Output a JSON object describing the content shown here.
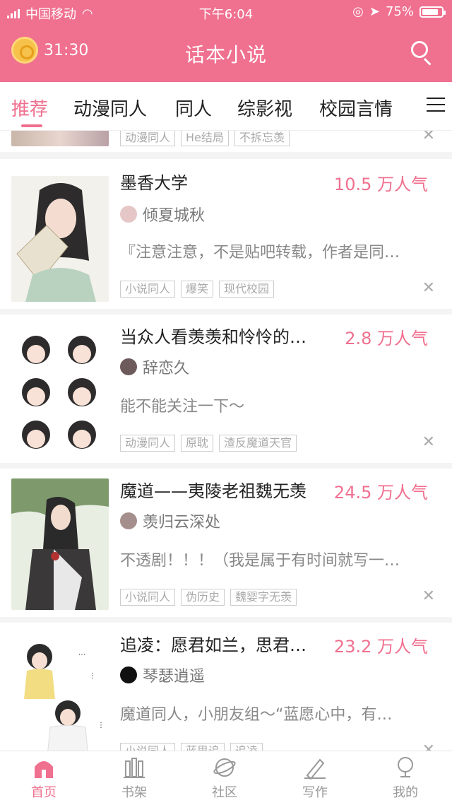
{
  "status": {
    "carrier": "中国移动",
    "time": "下午6:04",
    "battery": "75%"
  },
  "header": {
    "timer": "31:30",
    "title": "话本小说"
  },
  "tabs": [
    "推荐",
    "动漫同人",
    "同人",
    "综影视",
    "校园言情"
  ],
  "top_card": {
    "tags": [
      "动漫同人",
      "He结局",
      "不拆忘羡"
    ]
  },
  "cards": [
    {
      "title": "墨香大学",
      "popularity": "10.5 万人气",
      "author": "倾夏城秋",
      "desc": "『注意注意，不是贴吧转载，作者是同…",
      "tags": [
        "小说同人",
        "爆笑",
        "现代校园"
      ]
    },
    {
      "title": "当众人看羡羡和怜怜的…",
      "popularity": "2.8 万人气",
      "author": "辞恋久",
      "desc": "能不能关注一下～",
      "tags": [
        "动漫同人",
        "原耽",
        "渣反魔道天官"
      ]
    },
    {
      "title": "魔道——夷陵老祖魏无羡",
      "popularity": "24.5 万人气",
      "author": "羡归云深处",
      "desc": "不透剧！！！（我是属于有时间就写一…",
      "tags": [
        "小说同人",
        "伪历史",
        "魏婴字无羡"
      ]
    },
    {
      "title": "追凌：愿君如兰，思君…",
      "popularity": "23.2 万人气",
      "author": "琴瑟逍遥",
      "desc": "魔道同人，小朋友组～“蓝愿心中，有…",
      "tags": [
        "小说同人",
        "蓝思追",
        "追凌"
      ]
    }
  ],
  "bottom_nav": [
    "首页",
    "书架",
    "社区",
    "写作",
    "我的"
  ],
  "colors": {
    "brand": "#f0708f"
  }
}
